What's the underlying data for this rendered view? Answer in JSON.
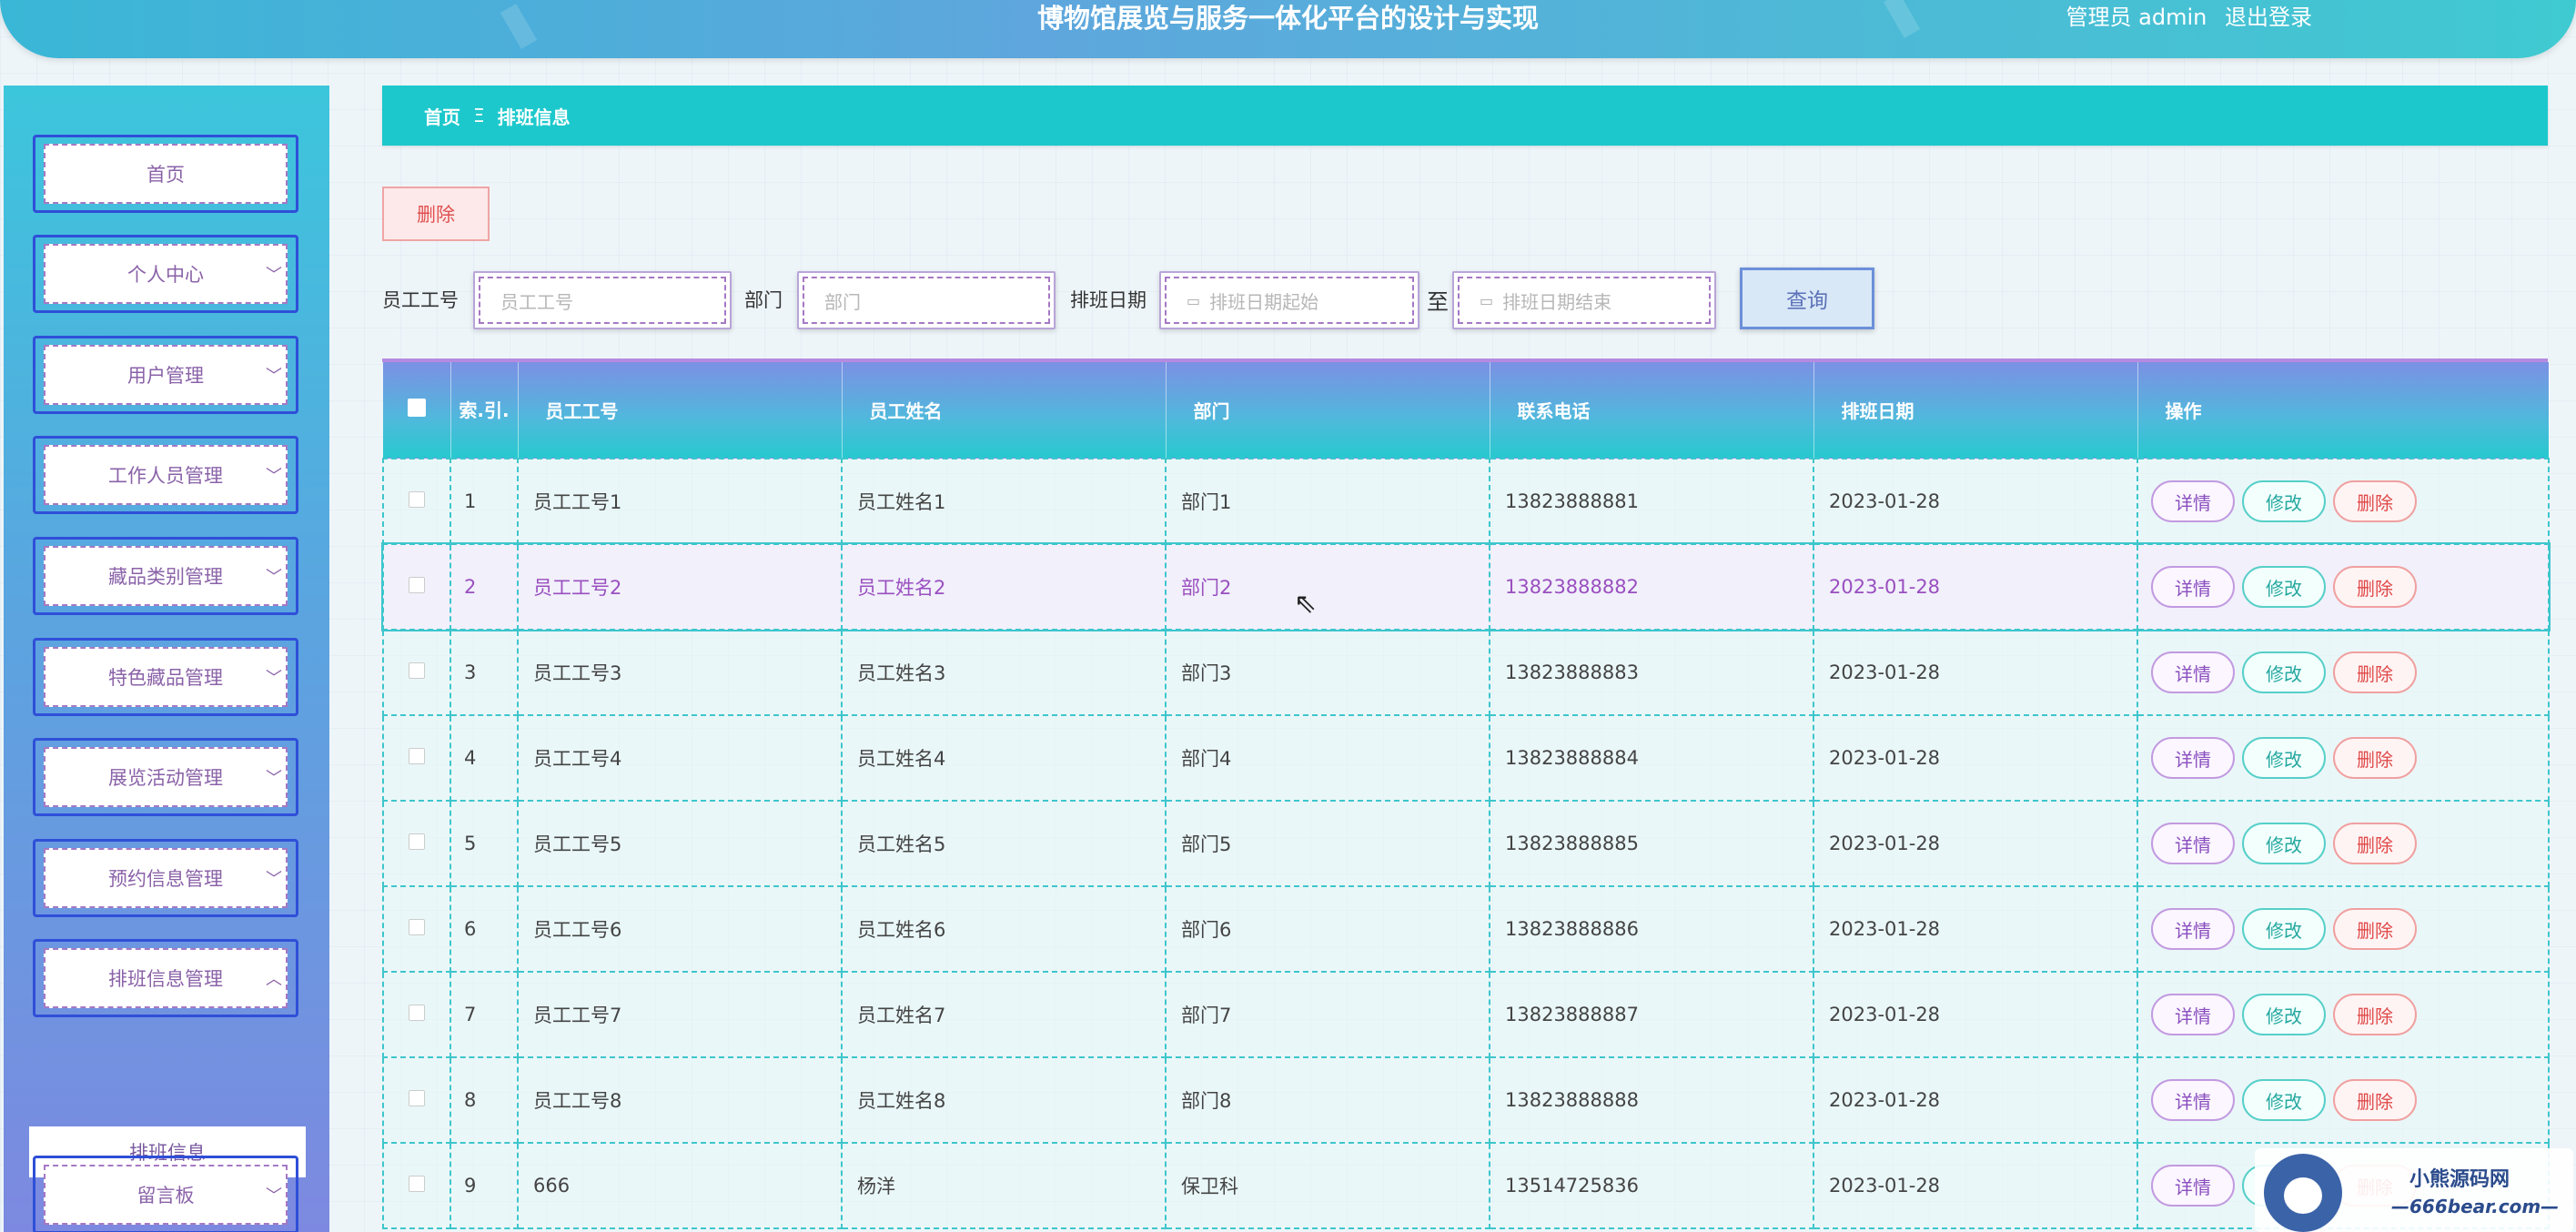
{
  "header": {
    "title": "博物馆展览与服务一体化平台的设计与实现",
    "user_label": "管理员 admin",
    "logout_label": "退出登录"
  },
  "sidebar": {
    "items": [
      {
        "label": "首页",
        "has_chevron": false
      },
      {
        "label": "个人中心",
        "has_chevron": true
      },
      {
        "label": "用户管理",
        "has_chevron": true
      },
      {
        "label": "工作人员管理",
        "has_chevron": true
      },
      {
        "label": "藏品类别管理",
        "has_chevron": true
      },
      {
        "label": "特色藏品管理",
        "has_chevron": true
      },
      {
        "label": "展览活动管理",
        "has_chevron": true
      },
      {
        "label": "预约信息管理",
        "has_chevron": true
      },
      {
        "label": "排班信息管理",
        "has_chevron": true,
        "expanded": true
      },
      {
        "label": "留言板",
        "has_chevron": true
      }
    ],
    "submenu_active": "排班信息"
  },
  "breadcrumb": {
    "home": "首页",
    "separator": "Ξ",
    "current": "排班信息"
  },
  "toolbar": {
    "delete_label": "删除"
  },
  "search": {
    "emp_no_label": "员工工号",
    "emp_no_placeholder": "员工工号",
    "dept_label": "部门",
    "dept_placeholder": "部门",
    "date_label": "排班日期",
    "date_start_placeholder": "排班日期起始",
    "to_label": "至",
    "date_end_placeholder": "排班日期结束",
    "query_label": "查询"
  },
  "table": {
    "headers": [
      "索.引.",
      "员工工号",
      "员工姓名",
      "部门",
      "联系电话",
      "排班日期",
      "操作"
    ],
    "rows": [
      {
        "idx": "1",
        "emp_no": "员工工号1",
        "name": "员工姓名1",
        "dept": "部门1",
        "phone": "13823888881",
        "date": "2023-01-28"
      },
      {
        "idx": "2",
        "emp_no": "员工工号2",
        "name": "员工姓名2",
        "dept": "部门2",
        "phone": "13823888882",
        "date": "2023-01-28"
      },
      {
        "idx": "3",
        "emp_no": "员工工号3",
        "name": "员工姓名3",
        "dept": "部门3",
        "phone": "13823888883",
        "date": "2023-01-28"
      },
      {
        "idx": "4",
        "emp_no": "员工工号4",
        "name": "员工姓名4",
        "dept": "部门4",
        "phone": "13823888884",
        "date": "2023-01-28"
      },
      {
        "idx": "5",
        "emp_no": "员工工号5",
        "name": "员工姓名5",
        "dept": "部门5",
        "phone": "13823888885",
        "date": "2023-01-28"
      },
      {
        "idx": "6",
        "emp_no": "员工工号6",
        "name": "员工姓名6",
        "dept": "部门6",
        "phone": "13823888886",
        "date": "2023-01-28"
      },
      {
        "idx": "7",
        "emp_no": "员工工号7",
        "name": "员工姓名7",
        "dept": "部门7",
        "phone": "13823888887",
        "date": "2023-01-28"
      },
      {
        "idx": "8",
        "emp_no": "员工工号8",
        "name": "员工姓名8",
        "dept": "部门8",
        "phone": "13823888888",
        "date": "2023-01-28"
      },
      {
        "idx": "9",
        "emp_no": "666",
        "name": "杨洋",
        "dept": "保卫科",
        "phone": "13514725836",
        "date": "2023-01-28"
      }
    ],
    "actions": {
      "detail": "详情",
      "edit": "修改",
      "delete": "删除"
    }
  },
  "watermark": {
    "line1": "小熊源码网",
    "line2": "—666bear.com—"
  },
  "colors": {
    "accent": "#1cc8cc",
    "sidebar_top": "#3cc6dc",
    "sidebar_bottom": "#7d89e0",
    "danger": "#e05050",
    "purple": "#8a4fbf"
  }
}
